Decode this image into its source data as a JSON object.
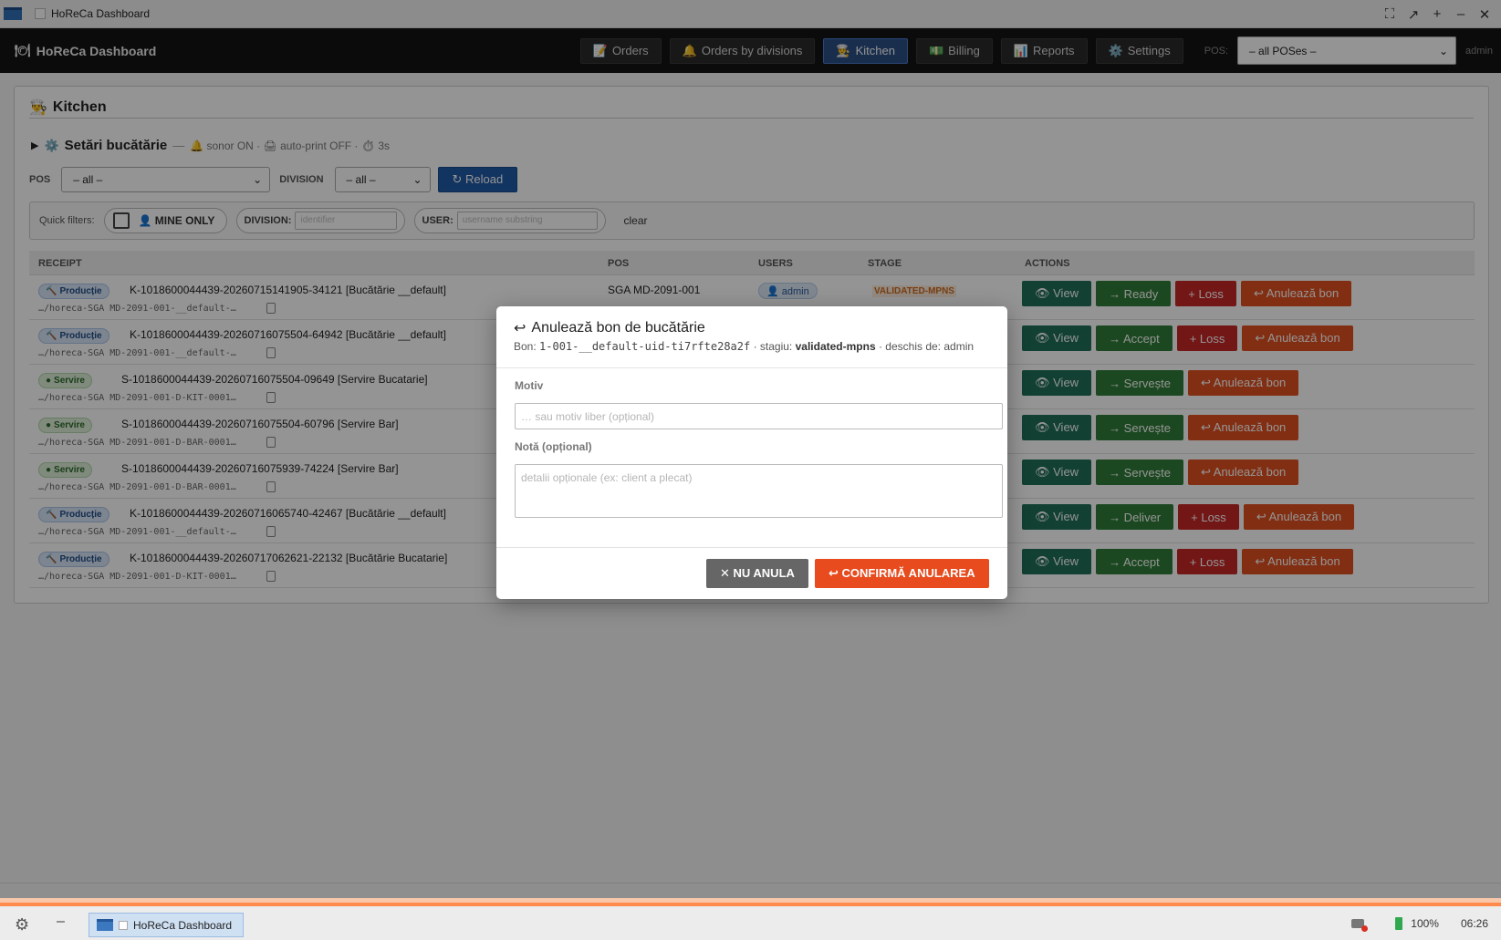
{
  "window": {
    "title": "HoReCa Dashboard",
    "controls": [
      "⛶",
      "↗",
      "+",
      "–",
      "✕"
    ]
  },
  "appbar": {
    "brand": "HoReCa Dashboard",
    "brand_icon": "🍽",
    "nav": [
      {
        "label": "Orders",
        "icon": "📝"
      },
      {
        "label": "Orders by divisions",
        "icon": "🔔"
      },
      {
        "label": "Kitchen",
        "icon": "👨‍🍳",
        "active": true
      },
      {
        "label": "Billing",
        "icon": "💵"
      },
      {
        "label": "Reports",
        "icon": "📊"
      },
      {
        "label": "Settings",
        "icon": "⚙️"
      }
    ],
    "pos_label": "POS:",
    "pos_value": "– all POSes –",
    "user": "admin"
  },
  "kitchen": {
    "title": "Kitchen",
    "icon": "👨‍🍳",
    "settings": {
      "arrow": "▶",
      "icon": "⚙️",
      "title": "Setări bucătărie",
      "dash": "—",
      "meta": "🔔 sonor ON · 🖨 auto-print OFF · ⏱ 3s"
    },
    "filters": {
      "pos_label": "POS",
      "pos_value": "– all –",
      "division_label": "DIVISION",
      "division_value": "– all –",
      "reload": "↻ Reload"
    },
    "quick": {
      "label": "Quick filters:",
      "mine": "👤 MINE ONLY",
      "division_label": "DIVISION:",
      "division_placeholder": "identifier",
      "user_label": "USER:",
      "user_placeholder": "username substring",
      "clear": "clear"
    },
    "columns": [
      "RECEIPT",
      "POS",
      "USERS",
      "STAGE",
      "ACTIONS"
    ],
    "rows": [
      {
        "tag": "Producție",
        "tag_type": "prod",
        "tag_icon": "🔨",
        "title": "K-1018600044439-20260715141905-34121 [Bucătărie __default]",
        "path": "…/horeca-SGA MD-2091-001-__default-…",
        "pos": "SGA MD-2091-001",
        "user": "👤 admin",
        "stage": "VALIDATED-MPNS",
        "actions": [
          {
            "t": "👁 View",
            "k": "view"
          },
          {
            "t": "→ Ready",
            "k": "next"
          },
          {
            "t": "+ Loss",
            "k": "loss"
          },
          {
            "t": "↩ Anulează bon",
            "k": "cancel"
          }
        ]
      },
      {
        "tag": "Producție",
        "tag_type": "prod",
        "tag_icon": "🔨",
        "title": "K-1018600044439-20260716075504-64942 [Bucătărie __default]",
        "path": "…/horeca-SGA MD-2091-001-__default-…",
        "pos": "",
        "user": "",
        "stage": "",
        "actions": [
          {
            "t": "👁 View",
            "k": "view"
          },
          {
            "t": "→ Accept",
            "k": "next"
          },
          {
            "t": "+ Loss",
            "k": "loss"
          },
          {
            "t": "↩ Anulează bon",
            "k": "cancel"
          }
        ]
      },
      {
        "tag": "Servire",
        "tag_type": "serv",
        "tag_icon": "●",
        "title": "S-1018600044439-20260716075504-09649 [Servire Bucatarie]",
        "path": "…/horeca-SGA MD-2091-001-D-KIT-0001…",
        "pos": "",
        "user": "",
        "stage": "",
        "actions": [
          {
            "t": "👁 View",
            "k": "view"
          },
          {
            "t": "→ Servește",
            "k": "next"
          },
          {
            "t": "↩ Anulează bon",
            "k": "cancel"
          }
        ]
      },
      {
        "tag": "Servire",
        "tag_type": "serv",
        "tag_icon": "●",
        "title": "S-1018600044439-20260716075504-60796 [Servire Bar]",
        "path": "…/horeca-SGA MD-2091-001-D-BAR-0001…",
        "pos": "",
        "user": "",
        "stage": "",
        "actions": [
          {
            "t": "👁 View",
            "k": "view"
          },
          {
            "t": "→ Servește",
            "k": "next"
          },
          {
            "t": "↩ Anulează bon",
            "k": "cancel"
          }
        ]
      },
      {
        "tag": "Servire",
        "tag_type": "serv",
        "tag_icon": "●",
        "title": "S-1018600044439-20260716075939-74224 [Servire Bar]",
        "path": "…/horeca-SGA MD-2091-001-D-BAR-0001…",
        "pos": "",
        "user": "",
        "stage": "",
        "actions": [
          {
            "t": "👁 View",
            "k": "view"
          },
          {
            "t": "→ Servește",
            "k": "next"
          },
          {
            "t": "↩ Anulează bon",
            "k": "cancel"
          }
        ]
      },
      {
        "tag": "Producție",
        "tag_type": "prod",
        "tag_icon": "🔨",
        "title": "K-1018600044439-20260716065740-42467 [Bucătărie __default]",
        "path": "…/horeca-SGA MD-2091-001-__default-…",
        "pos": "",
        "user": "",
        "stage": "",
        "actions": [
          {
            "t": "👁 View",
            "k": "view"
          },
          {
            "t": "→ Deliver",
            "k": "next"
          },
          {
            "t": "+ Loss",
            "k": "loss"
          },
          {
            "t": "↩ Anulează bon",
            "k": "cancel"
          }
        ]
      },
      {
        "tag": "Producție",
        "tag_type": "prod",
        "tag_icon": "🔨",
        "title": "K-1018600044439-20260717062621-22132 [Bucătărie Bucatarie]",
        "path": "…/horeca-SGA MD-2091-001-D-KIT-0001…",
        "pos": "",
        "user": "",
        "stage": "",
        "actions": [
          {
            "t": "👁 View",
            "k": "view"
          },
          {
            "t": "→ Accept",
            "k": "next"
          },
          {
            "t": "+ Loss",
            "k": "loss"
          },
          {
            "t": "↩ Anulează bon",
            "k": "cancel"
          }
        ]
      }
    ]
  },
  "modal": {
    "icon": "↩",
    "title": "Anulează bon de bucătărie",
    "bon_label": "Bon:",
    "bon_value": "1-001-__default-uid-ti7rfte28a2f",
    "stage_label": "· stagiu:",
    "stage_value": "validated-mpns",
    "opened_label": "· deschis de:",
    "opened_value": "admin",
    "motiv_label": "Motiv",
    "motiv_placeholder": "… sau motiv liber (opțional)",
    "nota_label": "Notă (opțional)",
    "nota_placeholder": "detalii opționale (ex: client a plecat)",
    "no_button": "✕ NU ANULA",
    "yes_button": "↩ CONFIRMĂ ANULAREA"
  },
  "taskbar": {
    "task": "HoReCa Dashboard",
    "battery": "100%",
    "clock": "06:26"
  }
}
